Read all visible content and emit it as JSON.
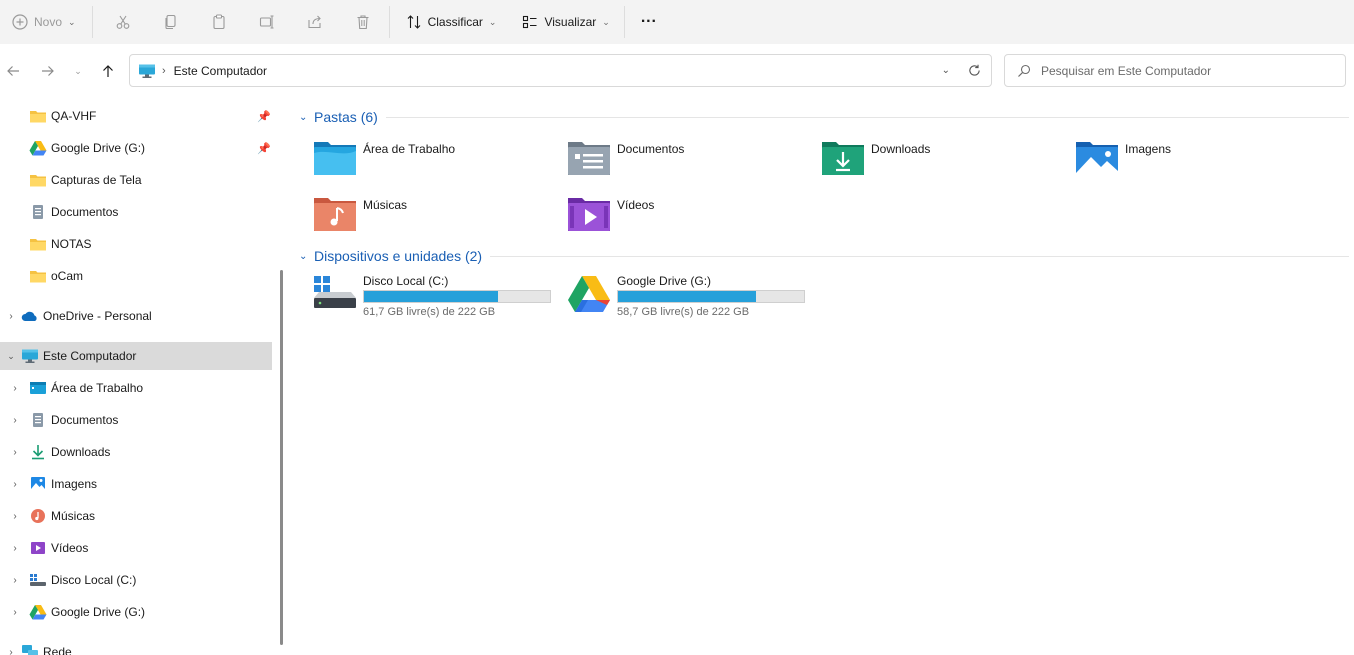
{
  "toolbar": {
    "new_label": "Novo",
    "sort_label": "Classificar",
    "view_label": "Visualizar",
    "more_label": "···",
    "icons": [
      "cut-icon",
      "copy-icon",
      "paste-icon",
      "rename-icon",
      "share-icon",
      "delete-icon"
    ]
  },
  "address": {
    "crumb": "Este Computador"
  },
  "search": {
    "placeholder": "Pesquisar em Este Computador"
  },
  "sidebar": {
    "pinned": [
      {
        "label": "QA-VHF",
        "icon": "folder-icon",
        "pinned": true
      },
      {
        "label": "Google Drive (G:)",
        "icon": "google-drive-icon",
        "pinned": true
      },
      {
        "label": "Capturas de Tela",
        "icon": "folder-icon",
        "pinned": false
      },
      {
        "label": "Documentos",
        "icon": "documents-icon",
        "pinned": false
      },
      {
        "label": "NOTAS",
        "icon": "folder-icon",
        "pinned": false
      },
      {
        "label": "oCam",
        "icon": "folder-icon",
        "pinned": false
      }
    ],
    "onedrive": "OneDrive - Personal",
    "this_pc": "Este Computador",
    "pc_children": [
      {
        "label": "Área de Trabalho",
        "icon": "desktop-icon"
      },
      {
        "label": "Documentos",
        "icon": "documents-icon"
      },
      {
        "label": "Downloads",
        "icon": "download-icon"
      },
      {
        "label": "Imagens",
        "icon": "pictures-icon"
      },
      {
        "label": "Músicas",
        "icon": "music-icon"
      },
      {
        "label": "Vídeos",
        "icon": "videos-icon"
      },
      {
        "label": "Disco Local (C:)",
        "icon": "local-disk-icon"
      },
      {
        "label": "Google Drive (G:)",
        "icon": "google-drive-icon"
      }
    ],
    "network": "Rede"
  },
  "content": {
    "folders_header": "Pastas (6)",
    "folders": [
      {
        "label": "Área de Trabalho",
        "icon": "desktop-folder-icon"
      },
      {
        "label": "Documentos",
        "icon": "documents-folder-icon"
      },
      {
        "label": "Downloads",
        "icon": "downloads-folder-icon"
      },
      {
        "label": "Imagens",
        "icon": "pictures-folder-icon"
      },
      {
        "label": "Músicas",
        "icon": "music-folder-icon"
      },
      {
        "label": "Vídeos",
        "icon": "videos-folder-icon"
      }
    ],
    "devices_header": "Dispositivos e unidades (2)",
    "drives": [
      {
        "label": "Disco Local (C:)",
        "free": "61,7 GB livre(s) de 222 GB",
        "used_fraction": 0.72,
        "icon": "local-disk-icon"
      },
      {
        "label": "Google Drive (G:)",
        "free": "58,7 GB livre(s) de 222 GB",
        "used_fraction": 0.74,
        "icon": "google-drive-icon"
      }
    ]
  },
  "colors": {
    "accent": "#1a5fb4",
    "selection": "#dadada",
    "drive_bar": "#26a0da"
  }
}
